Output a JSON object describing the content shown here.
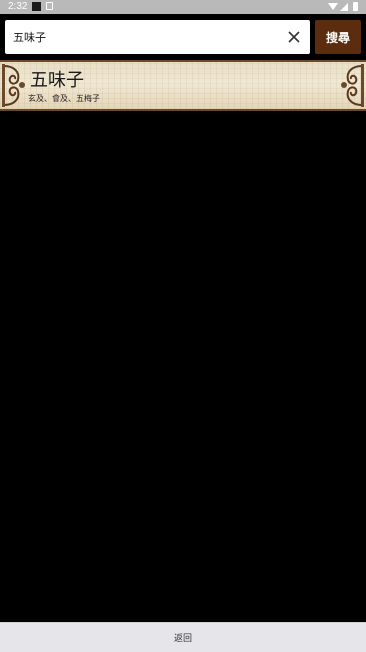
{
  "status_bar": {
    "time": "2:32",
    "icons": [
      "notification-square-icon",
      "notification-badge-icon",
      "wifi-icon",
      "signal-icon",
      "battery-icon"
    ]
  },
  "search": {
    "value": "五味子",
    "placeholder": "",
    "button_label": "搜尋"
  },
  "results": [
    {
      "title": "五味子",
      "subtitle": "玄及、會及、五梅子"
    }
  ],
  "footer": {
    "back_label": "返回"
  },
  "colors": {
    "search_button": "#5b2d0e",
    "background": "#000000",
    "card_paper": "#efe6cf",
    "card_border": "#6b4a2a",
    "bottom_bar": "#e6e5ea"
  }
}
